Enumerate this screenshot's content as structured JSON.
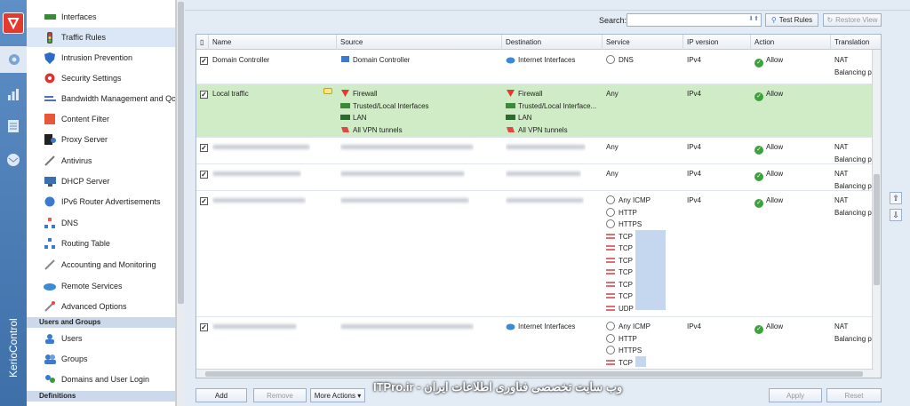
{
  "app": {
    "brand": "KerioControl"
  },
  "nav": {
    "items": [
      {
        "label": "Interfaces",
        "icon": "interfaces-icon"
      },
      {
        "label": "Traffic Rules",
        "icon": "traffic-rules-icon"
      },
      {
        "label": "Intrusion Prevention",
        "icon": "shield-icon"
      },
      {
        "label": "Security Settings",
        "icon": "security-icon"
      },
      {
        "label": "Bandwidth Management and Qo",
        "icon": "bandwidth-icon"
      },
      {
        "label": "Content Filter",
        "icon": "filter-icon"
      },
      {
        "label": "Proxy Server",
        "icon": "proxy-icon"
      },
      {
        "label": "Antivirus",
        "icon": "antivirus-icon"
      },
      {
        "label": "DHCP Server",
        "icon": "dhcp-icon"
      },
      {
        "label": "IPv6 Router Advertisements",
        "icon": "ipv6-icon"
      },
      {
        "label": "DNS",
        "icon": "dns-icon"
      },
      {
        "label": "Routing Table",
        "icon": "routing-icon"
      },
      {
        "label": "Accounting and Monitoring",
        "icon": "monitoring-icon"
      },
      {
        "label": "Remote Services",
        "icon": "cloud-icon"
      },
      {
        "label": "Advanced Options",
        "icon": "options-icon"
      }
    ],
    "section_users": "Users and Groups",
    "user_items": [
      {
        "label": "Users",
        "icon": "users-icon"
      },
      {
        "label": "Groups",
        "icon": "groups-icon"
      },
      {
        "label": "Domains and User Login",
        "icon": "domains-icon"
      }
    ],
    "section_definitions": "Definitions"
  },
  "toolbar": {
    "search_label": "Search:",
    "search_value": "",
    "test_rules": "Test Rules",
    "restore_view": "Restore View"
  },
  "columns": [
    "Name",
    "Source",
    "Destination",
    "Service",
    "IP version",
    "Action",
    "Translation"
  ],
  "rows": [
    {
      "checked": "✓",
      "name": "Domain Controller",
      "source": [
        "Domain Controller"
      ],
      "destination": [
        "Internet Interfaces"
      ],
      "service": [
        "DNS"
      ],
      "ip": "IPv4",
      "action": "Allow",
      "translation": [
        "NAT",
        "Balancing p"
      ]
    },
    {
      "checked": "✓",
      "name": "Local traffic",
      "source": [
        "Firewall",
        "Trusted/Local Interfaces",
        "LAN",
        "All VPN tunnels"
      ],
      "destination": [
        "Firewall",
        "Trusted/Local Interface...",
        "LAN",
        "All VPN tunnels"
      ],
      "service": [
        "Any"
      ],
      "ip": "IPv4",
      "action": "Allow",
      "translation": []
    },
    {
      "checked": "✓",
      "service": [
        "Any"
      ],
      "ip": "IPv4",
      "action": "Allow",
      "translation": [
        "NAT",
        "Balancing p"
      ]
    },
    {
      "checked": "✓",
      "service": [
        "Any"
      ],
      "ip": "IPv4",
      "action": "Allow",
      "translation": [
        "NAT",
        "Balancing p"
      ]
    },
    {
      "checked": "✓",
      "service": [
        "Any ICMP",
        "HTTP",
        "HTTPS",
        "TCP",
        "TCP",
        "TCP",
        "TCP",
        "TCP",
        "TCP",
        "UDP"
      ],
      "ip": "IPv4",
      "action": "Allow",
      "translation": [
        "NAT",
        "Balancing p"
      ]
    },
    {
      "checked": "✓",
      "destination": [
        "Internet Interfaces"
      ],
      "service": [
        "Any ICMP",
        "HTTP",
        "HTTPS",
        "TCP"
      ],
      "ip": "IPv4",
      "action": "Allow",
      "translation": [
        "NAT",
        "Balancing p"
      ]
    }
  ],
  "buttons": {
    "add": "Add",
    "remove": "Remove",
    "more_actions": "More Actions ▾",
    "apply": "Apply",
    "reset": "Reset"
  },
  "watermark": "ITPro.ir - وب سایت تخصصی فناوری اطلاعات ایران"
}
